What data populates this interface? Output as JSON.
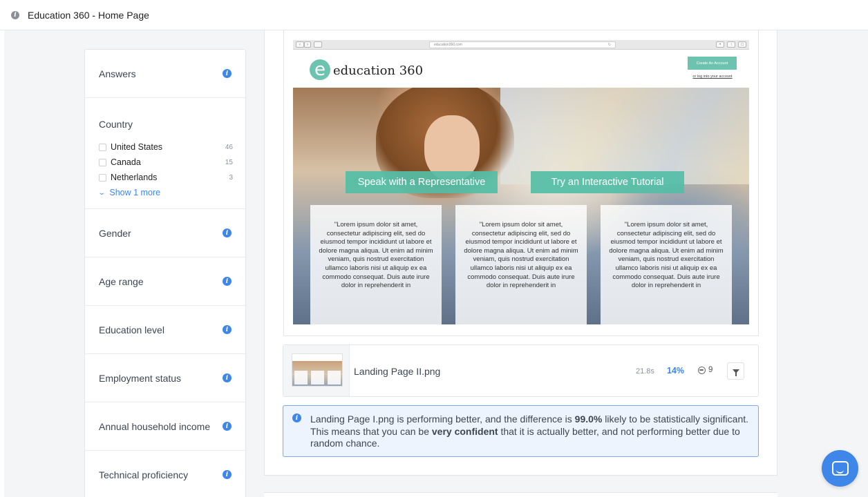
{
  "window": {
    "title": "Education 360 - Home Page"
  },
  "sidebar": {
    "sections": [
      {
        "title": "Answers"
      },
      {
        "title": "Country"
      },
      {
        "title": "Gender"
      },
      {
        "title": "Age range"
      },
      {
        "title": "Education level"
      },
      {
        "title": "Employment status"
      },
      {
        "title": "Annual household income"
      },
      {
        "title": "Technical proficiency"
      }
    ],
    "country_items": [
      {
        "name": "United States",
        "count": "46"
      },
      {
        "name": "Canada",
        "count": "15"
      },
      {
        "name": "Netherlands",
        "count": "3"
      }
    ],
    "show_more": "Show 1 more"
  },
  "preview": {
    "url": "education360.com",
    "logo_letter": "e",
    "logo_text": "education 360",
    "create_account": "Create An Account",
    "login_link": "or log into your account",
    "cta_left": "Speak with a Representative",
    "cta_right": "Try an Interactive Tutorial",
    "card_text": "\"Lorem ipsum dolor sit amet, consectetur adipiscing elit, sed do eiusmod tempor incididunt ut labore et dolore magna aliqua. Ut enim ad minim veniam, quis nostrud exercitation ullamco laboris nisi ut aliquip ex ea commodo consequat. Duis aute irure dolor in reprehenderit in"
  },
  "result": {
    "name": "Landing Page II.png",
    "time": "21.8s",
    "percent": "14%",
    "users": "9"
  },
  "banner": {
    "part1": "Landing Page I.png is performing better, and the difference is ",
    "bold1": "99.0%",
    "part2": " likely to be statistically significant. This means that you can be ",
    "bold2": "very confident",
    "part3": " that it is actually better, and not performing better due to random chance."
  },
  "colors": {
    "accent": "#3e86e8",
    "teal": "#6cc3b0",
    "banner_bg": "#edf4fd"
  }
}
